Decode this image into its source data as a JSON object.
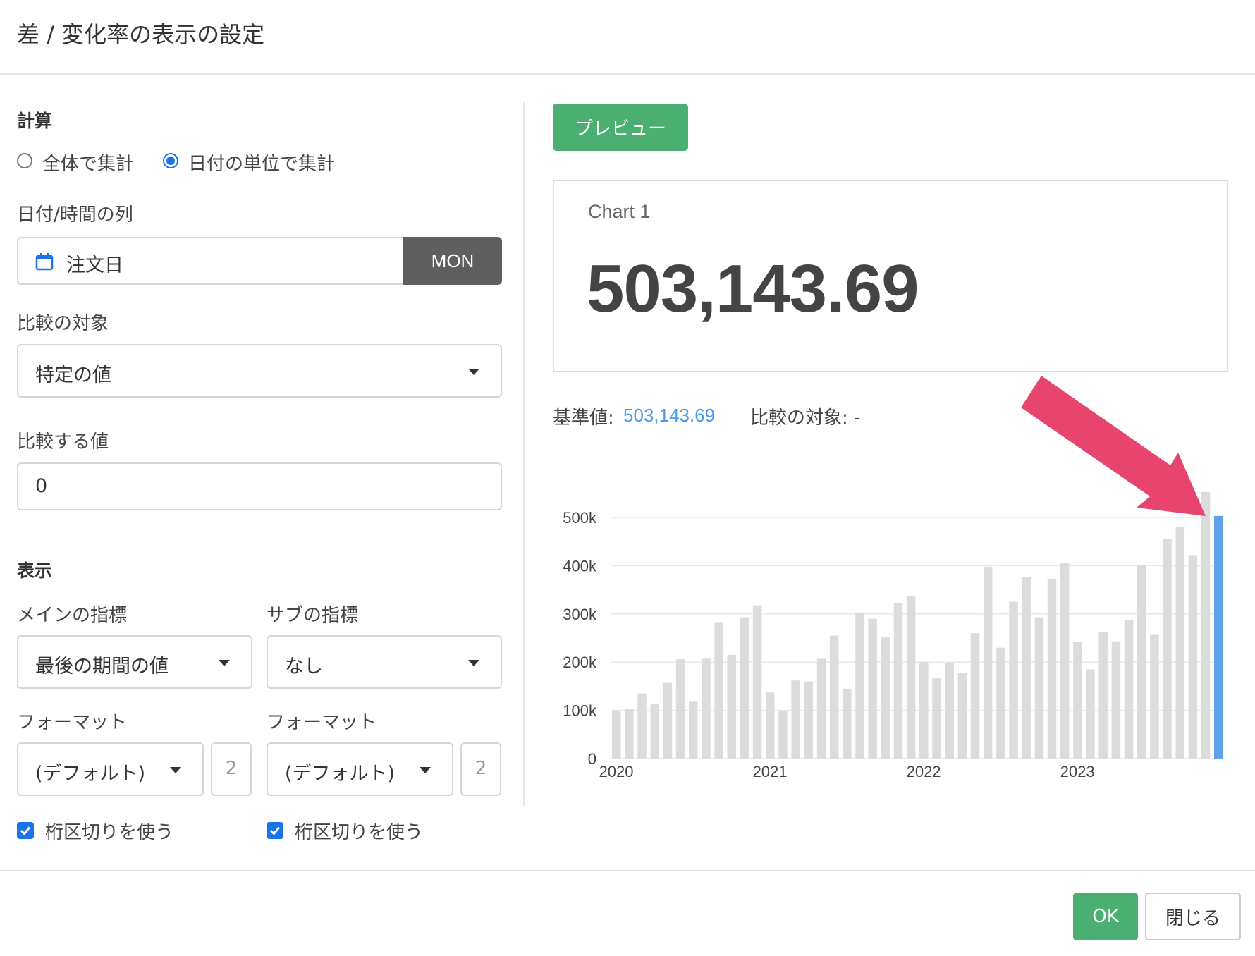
{
  "dialog": {
    "title": "差 / 変化率の表示の設定"
  },
  "calc": {
    "heading": "計算",
    "option_total": "全体で集計",
    "option_by_date": "日付の単位で集計",
    "selected": "option_by_date"
  },
  "date_col": {
    "label": "日付/時間の列",
    "value": "注文日",
    "unit_button": "MON"
  },
  "compare_target": {
    "label": "比較の対象",
    "selected": "特定の値"
  },
  "compare_value": {
    "label": "比較する値",
    "value": "0"
  },
  "display": {
    "heading": "表示",
    "main_metric_label": "メインの指標",
    "main_metric_value": "最後の期間の値",
    "sub_metric_label": "サブの指標",
    "sub_metric_value": "なし",
    "format_label_main": "フォーマット",
    "format_label_sub": "フォーマット",
    "format_main_value": "(デフォルト)",
    "format_sub_value": "(デフォルト)",
    "decimals_main": "2",
    "decimals_sub": "2",
    "separator_main_label": "桁区切りを使う",
    "separator_sub_label": "桁区切りを使う",
    "separator_main_checked": true,
    "separator_sub_checked": true
  },
  "preview": {
    "button": "プレビュー",
    "card_title": "Chart 1",
    "card_value": "503,143.69",
    "base_label": "基準値:",
    "base_value": "503,143.69",
    "compare_label": "比較の対象: -"
  },
  "footer": {
    "ok": "OK",
    "close": "閉じる"
  },
  "colors": {
    "accent": "#4caf72",
    "link_blue": "#4a9be8",
    "bar_gray": "#dcdcdc",
    "bar_highlight": "#5ea2ee",
    "arrow": "#e8456e"
  },
  "chart_data": {
    "type": "bar",
    "x_tick_labels": [
      "2020",
      "2021",
      "2022",
      "2023"
    ],
    "y_tick_labels": [
      "0",
      "100k",
      "200k",
      "300k",
      "400k",
      "500k"
    ],
    "ylim": [
      0,
      550000
    ],
    "grid": true,
    "values": [
      100000,
      103000,
      135000,
      113000,
      157000,
      206000,
      118000,
      207000,
      283000,
      215000,
      293000,
      318000,
      137000,
      100000,
      162000,
      160000,
      207000,
      255000,
      145000,
      303000,
      290000,
      252000,
      322000,
      338000,
      200000,
      167000,
      198000,
      178000,
      260000,
      398000,
      230000,
      325000,
      376000,
      293000,
      373000,
      405000,
      242000,
      185000,
      262000,
      243000,
      288000,
      401000,
      258000,
      455000,
      480000,
      422000,
      553000,
      503143.69
    ],
    "highlight_index": 47,
    "year_start_indices": [
      0,
      12,
      24,
      36
    ]
  }
}
